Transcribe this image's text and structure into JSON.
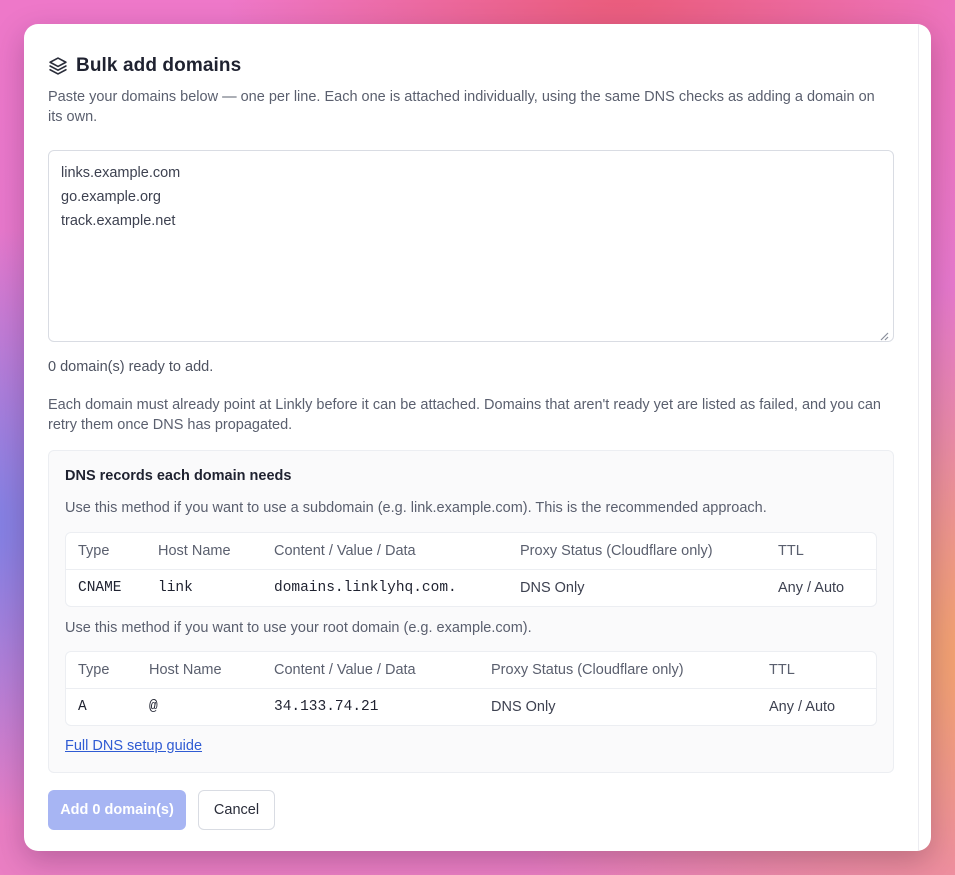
{
  "dialog": {
    "title": "Bulk add domains",
    "icon": "layers-icon",
    "subtitle": "Paste your domains below — one per line. Each one is attached individually, using the same DNS checks as adding a domain on its own."
  },
  "domains_input": {
    "value": "links.example.com\ngo.example.org\ntrack.example.net"
  },
  "status": {
    "count_text": "0 domain(s) ready to add.",
    "note": "Each domain must already point at Linkly before it can be attached. Domains that aren't ready yet are listed as failed, and you can retry them once DNS has propagated."
  },
  "dns": {
    "title": "DNS records each domain needs",
    "subdomain_method": "Use this method if you want to use a subdomain (e.g. link.example.com). This is the recommended approach.",
    "root_method": "Use this method if you want to use your root domain (e.g. example.com).",
    "columns": [
      "Type",
      "Host Name",
      "Content / Value / Data",
      "Proxy Status (Cloudflare only)",
      "TTL"
    ],
    "cname_record": {
      "type": "CNAME",
      "host": "link",
      "content": "domains.linklyhq.com.",
      "proxy": "DNS Only",
      "ttl": "Any / Auto"
    },
    "a_record": {
      "type": "A",
      "host": "@",
      "content": "34.133.74.21",
      "proxy": "DNS Only",
      "ttl": "Any / Auto"
    },
    "guide_link": "Full DNS setup guide"
  },
  "actions": {
    "submit_label": "Add 0 domain(s)",
    "cancel_label": "Cancel"
  },
  "colors": {
    "primary_disabled": "#a7b5f3",
    "link": "#2f5bd3"
  }
}
